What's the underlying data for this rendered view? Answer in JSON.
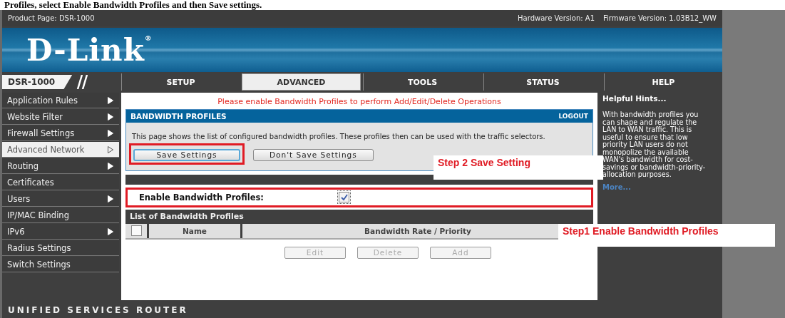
{
  "caption": "Profiles, select Enable Bandwidth Profiles and then Save settings.",
  "top_bar": {
    "product": "Product Page: DSR-1000",
    "hardware": "Hardware Version: A1",
    "firmware": "Firmware Version: 1.03B12_WW"
  },
  "logo": "D-Link$^{®}$",
  "model_tab": "DSR-1000",
  "tabs": [
    {
      "label": "SETUP",
      "selected": false
    },
    {
      "label": "ADVANCED",
      "selected": true
    },
    {
      "label": "TOOLS",
      "selected": false
    },
    {
      "label": "STATUS",
      "selected": false
    },
    {
      "label": "HELP",
      "selected": false
    }
  ],
  "sidebar": {
    "items": [
      {
        "label": "Application Rules",
        "submenu": true,
        "selected": false
      },
      {
        "label": "Website Filter",
        "submenu": true,
        "selected": false
      },
      {
        "label": "Firewall Settings",
        "submenu": true,
        "selected": false
      },
      {
        "label": "Advanced Network",
        "submenu": true,
        "selected": true
      },
      {
        "label": "Routing",
        "submenu": true,
        "selected": false
      },
      {
        "label": "Certificates",
        "submenu": false,
        "selected": false
      },
      {
        "label": "Users",
        "submenu": true,
        "selected": false
      },
      {
        "label": "IP/MAC Binding",
        "submenu": false,
        "selected": false
      },
      {
        "label": "IPv6",
        "submenu": true,
        "selected": false
      },
      {
        "label": "Radius Settings",
        "submenu": false,
        "selected": false
      },
      {
        "label": "Switch Settings",
        "submenu": false,
        "selected": false
      }
    ]
  },
  "notice": "Please enable Bandwidth Profiles to perform Add/Edit/Delete Operations",
  "panel": {
    "title": "BANDWIDTH PROFILES",
    "logout": "LOGOUT",
    "description": "This page shows the list of configured bandwidth profiles. These profiles then can be used with the traffic selectors.",
    "buttons": [
      {
        "label": "Save Settings",
        "highlighted": true
      },
      {
        "label": "Don't Save Settings",
        "highlighted": false
      }
    ]
  },
  "enable": {
    "label": "Enable Bandwidth Profiles:",
    "checked": true,
    "highlighted": true
  },
  "list": {
    "title": "List of Bandwidth Profiles",
    "select_all_checked": false,
    "columns": [
      "Name",
      "Bandwidth Rate / Priority"
    ],
    "buttons": [
      {
        "label": "Edit",
        "disabled": true
      },
      {
        "label": "Delete",
        "disabled": true
      },
      {
        "label": "Add",
        "disabled": true
      }
    ]
  },
  "help": {
    "title": "Helpful Hints...",
    "text": "With bandwidth profiles you can shape and regulate the LAN to WAN traffic. This is useful to ensure that low priority LAN users do not monopolize the available WAN's bandwidth for cost-savings or bandwidth-priority-allocation purposes.",
    "link": "More..."
  },
  "annotations": [
    {
      "text": "Step 2 Save Setting"
    },
    {
      "text": "Step1 Enable Bandwidth Profiles"
    }
  ],
  "footer": "UNIFIED SERVICES ROUTER"
}
